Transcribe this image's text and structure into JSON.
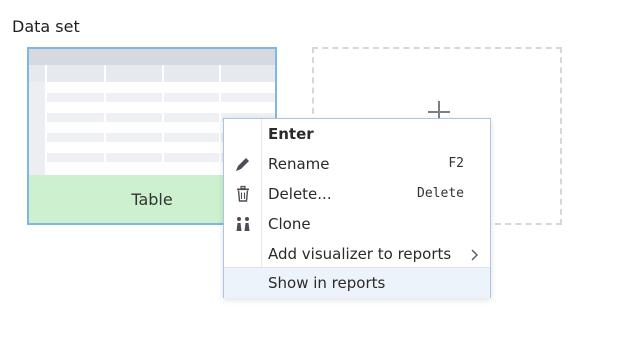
{
  "section": {
    "title": "Data set"
  },
  "dataset_card": {
    "label": "Table",
    "colors": {
      "border": "#7fb6e4",
      "footer": "#cdf1cf"
    }
  },
  "add_card": {
    "icon": "plus-icon"
  },
  "context_menu": {
    "items": [
      {
        "label": "Enter",
        "icon": "",
        "shortcut": ""
      },
      {
        "label": "Rename",
        "icon": "pencil-icon",
        "shortcut": "F2"
      },
      {
        "label": "Delete...",
        "icon": "trash-icon",
        "shortcut": "Delete"
      },
      {
        "label": "Clone",
        "icon": "clone-icon",
        "shortcut": ""
      },
      {
        "label": "Add visualizer to reports",
        "icon": "",
        "shortcut": "",
        "submenu": true
      },
      {
        "label": "Show in reports",
        "icon": "",
        "shortcut": "",
        "hovered": true
      }
    ],
    "colors": {
      "border": "#a9c6e3",
      "hover": "#ecf3fb"
    }
  }
}
